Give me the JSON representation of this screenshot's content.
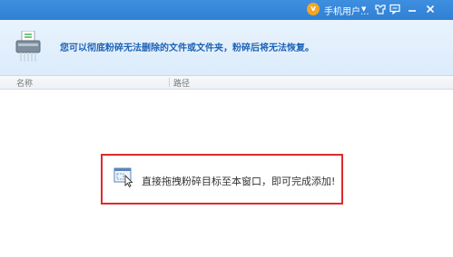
{
  "titlebar": {
    "user_badge": "v",
    "user_name": "手机用户...",
    "user_caret": "▼",
    "buttons": [
      "skin-icon",
      "feedback-icon",
      "minimize-icon",
      "close-icon"
    ]
  },
  "header": {
    "description": "您可以彻底粉碎无法删除的文件或文件夹，粉碎后将无法恢复。"
  },
  "columns": {
    "name": "名称",
    "path": "路径"
  },
  "drop_hint": {
    "text": "直接拖拽粉碎目标至本窗口，即可完成添加!"
  },
  "colors": {
    "titlebar": "#2f7fd4",
    "accent_text": "#1e63b6",
    "highlight_border": "#e0292a",
    "badge": "#f5a623"
  }
}
